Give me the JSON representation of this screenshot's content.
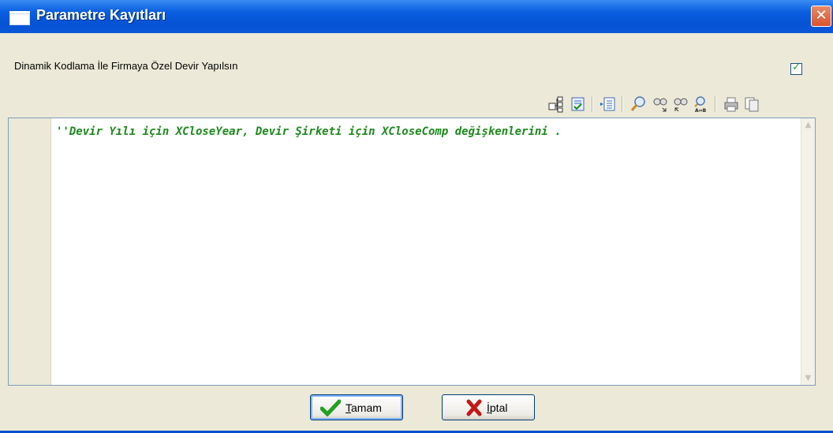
{
  "window": {
    "title": "Parametre Kayıtları",
    "close_glyph": "✕"
  },
  "option": {
    "label": "Dinamik Kodlama İle Firmaya Özel Devir Yapılsın",
    "checked": true,
    "check_glyph": "✓"
  },
  "toolbar": {
    "icons": [
      "tree-structure-icon",
      "checklist-icon",
      "indent-list-icon",
      "search-icon",
      "find-next-icon",
      "find-previous-icon",
      "replace-icon",
      "print-icon",
      "copy-document-icon"
    ]
  },
  "editor": {
    "code_line": "''Devir Yılı için XCloseYear, Devir Şirketi için XCloseComp değişkenlerini ."
  },
  "buttons": {
    "ok_label": "Tamam",
    "cancel_label": "İptal"
  },
  "colors": {
    "title_bar": "#0453d4",
    "code_text": "#1c8a1c",
    "ok_check": "#21a121",
    "cancel_x": "#c41818"
  }
}
